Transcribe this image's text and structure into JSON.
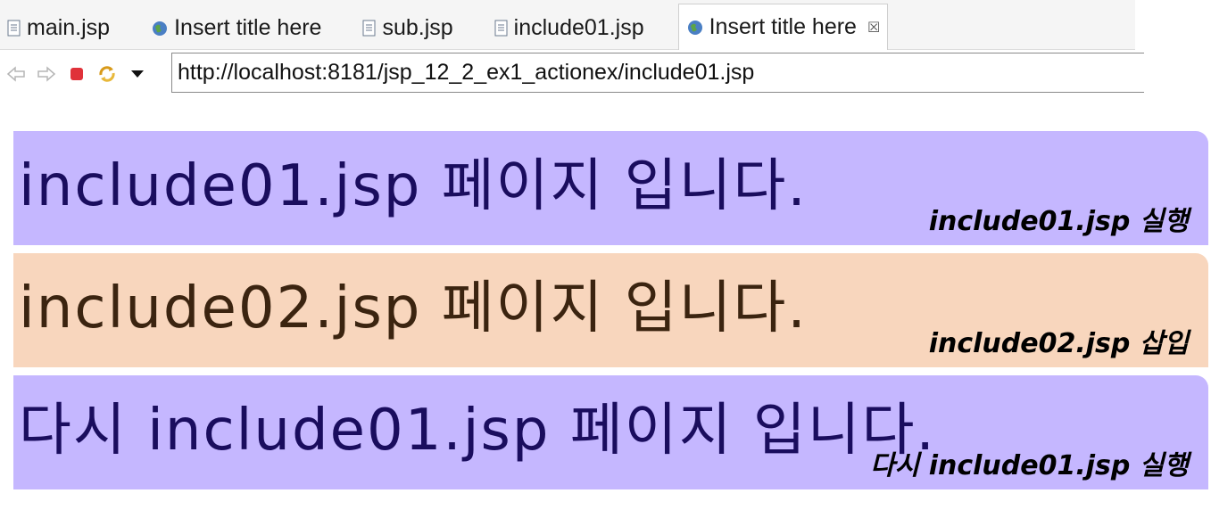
{
  "tabs": [
    {
      "label": "main.jsp",
      "icon": "jsp-file-icon",
      "active": false
    },
    {
      "label": "Insert title here",
      "icon": "globe-icon",
      "active": false
    },
    {
      "label": "sub.jsp",
      "icon": "jsp-file-icon",
      "active": false
    },
    {
      "label": "include01.jsp",
      "icon": "jsp-file-icon",
      "active": false
    },
    {
      "label": "Insert title here",
      "icon": "globe-icon",
      "active": true,
      "close": "☒"
    }
  ],
  "toolbar": {
    "back_icon": "back-arrow-icon",
    "forward_icon": "forward-arrow-icon",
    "stop_icon": "stop-icon",
    "refresh_icon": "refresh-icon",
    "dropdown_icon": "dropdown-arrow-icon",
    "url": "http://localhost:8181/jsp_12_2_ex1_actionex/include01.jsp"
  },
  "sections": [
    {
      "text": "include01.jsp 페이지 입니다.",
      "caption": "include01.jsp 실행",
      "bg": "#c5b7ff",
      "fg": "#1a0d5e"
    },
    {
      "text": "include02.jsp 페이지 입니다.",
      "caption": "include02.jsp 삽입",
      "bg": "#f8d6bd",
      "fg": "#3b2410"
    },
    {
      "text": "다시 include01.jsp 페이지 입니다.",
      "caption": "다시 include01.jsp 실행",
      "bg": "#c5b7ff",
      "fg": "#1a0d5e"
    }
  ]
}
